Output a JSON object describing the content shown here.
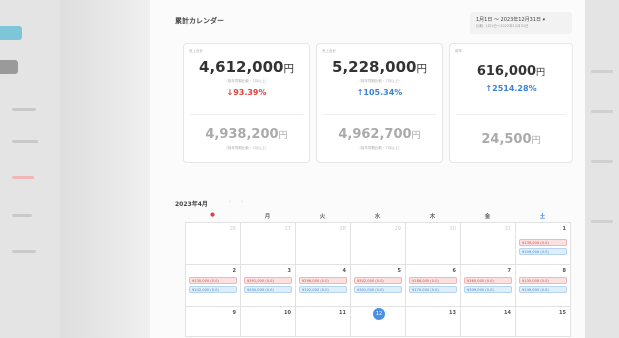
{
  "header": {
    "title": "累計カレンダー",
    "range_label": "1月1日 〜 2023年12月31日 ▾",
    "range_sub": "比較: 1月1日〜2022年12月31日"
  },
  "cards": [
    {
      "caption": "売上合計",
      "value": "4,612,000",
      "unit": "円",
      "sub": "（前年同期比較・7月以上）",
      "change": "↓93.39%",
      "change_color": "#e0413b",
      "prev_value": "4,938,200",
      "prev_unit": "円",
      "prev_sub": "（前年同期比較・7月以上）"
    },
    {
      "caption": "売上合計",
      "value": "5,228,000",
      "unit": "円",
      "sub": "（前年同期比較・7月以上）",
      "change": "↑105.34%",
      "change_color": "#3b82d6",
      "prev_value": "4,962,700",
      "prev_unit": "円",
      "prev_sub": "（前年同期比較・7月以上）"
    },
    {
      "caption": "前年",
      "value": "616,000",
      "unit": "円",
      "sub": "",
      "change": "↑2514.28%",
      "change_color": "#3b82d6",
      "prev_value": "24,500",
      "prev_unit": "円",
      "prev_sub": ""
    }
  ],
  "calendar": {
    "month": "2023年4月",
    "prev": "‹",
    "next": "›",
    "weekdays": [
      "●",
      "月",
      "火",
      "水",
      "木",
      "金",
      "土"
    ],
    "weekday_colors": [
      "#e0413b",
      "#666666",
      "#666666",
      "#666666",
      "#666666",
      "#666666",
      "#3b82d6"
    ],
    "weeks": [
      [
        {
          "d": "26",
          "muted": true,
          "chips": []
        },
        {
          "d": "27",
          "muted": true,
          "chips": []
        },
        {
          "d": "28",
          "muted": true,
          "chips": []
        },
        {
          "d": "29",
          "muted": true,
          "chips": []
        },
        {
          "d": "30",
          "muted": true,
          "chips": []
        },
        {
          "d": "31",
          "muted": true,
          "chips": []
        },
        {
          "d": "1",
          "muted": false,
          "chips": [
            {
              "t": "¥139,000 (0.0)",
              "c": "red"
            },
            {
              "t": "¥109,000 (0.0)",
              "c": "blue"
            }
          ]
        }
      ],
      [
        {
          "d": "2",
          "muted": false,
          "chips": [
            {
              "t": "¥130,000 (0.0)",
              "c": "red"
            },
            {
              "t": "¥102,000 (0.0)",
              "c": "blue"
            }
          ]
        },
        {
          "d": "3",
          "muted": false,
          "chips": [
            {
              "t": "¥391,000 (0.0)",
              "c": "red"
            },
            {
              "t": "¥300,000 (0.0)",
              "c": "blue"
            }
          ]
        },
        {
          "d": "4",
          "muted": false,
          "chips": [
            {
              "t": "¥296,000 (0.0)",
              "c": "red"
            },
            {
              "t": "¥102,000 (0.0)",
              "c": "blue"
            }
          ]
        },
        {
          "d": "5",
          "muted": false,
          "chips": [
            {
              "t": "¥302,000 (0.0)",
              "c": "red"
            },
            {
              "t": "¥301,000 (0.0)",
              "c": "blue"
            }
          ]
        },
        {
          "d": "6",
          "muted": false,
          "chips": [
            {
              "t": "¥188,000 (0.0)",
              "c": "red"
            },
            {
              "t": "¥170,000 (0.0)",
              "c": "blue"
            }
          ]
        },
        {
          "d": "7",
          "muted": false,
          "chips": [
            {
              "t": "¥360,000 (0.0)",
              "c": "red"
            },
            {
              "t": "¥309,000 (0.0)",
              "c": "blue"
            }
          ]
        },
        {
          "d": "8",
          "muted": false,
          "chips": [
            {
              "t": "¥135,000 (0.0)",
              "c": "red"
            },
            {
              "t": "¥139,000 (0.0)",
              "c": "blue"
            }
          ]
        }
      ],
      [
        {
          "d": "9",
          "muted": false,
          "chips": []
        },
        {
          "d": "10",
          "muted": false,
          "chips": []
        },
        {
          "d": "11",
          "muted": false,
          "chips": []
        },
        {
          "d": "12",
          "muted": false,
          "today": true,
          "chips": []
        },
        {
          "d": "13",
          "muted": false,
          "chips": []
        },
        {
          "d": "14",
          "muted": false,
          "chips": []
        },
        {
          "d": "15",
          "muted": false,
          "chips": []
        }
      ]
    ]
  }
}
